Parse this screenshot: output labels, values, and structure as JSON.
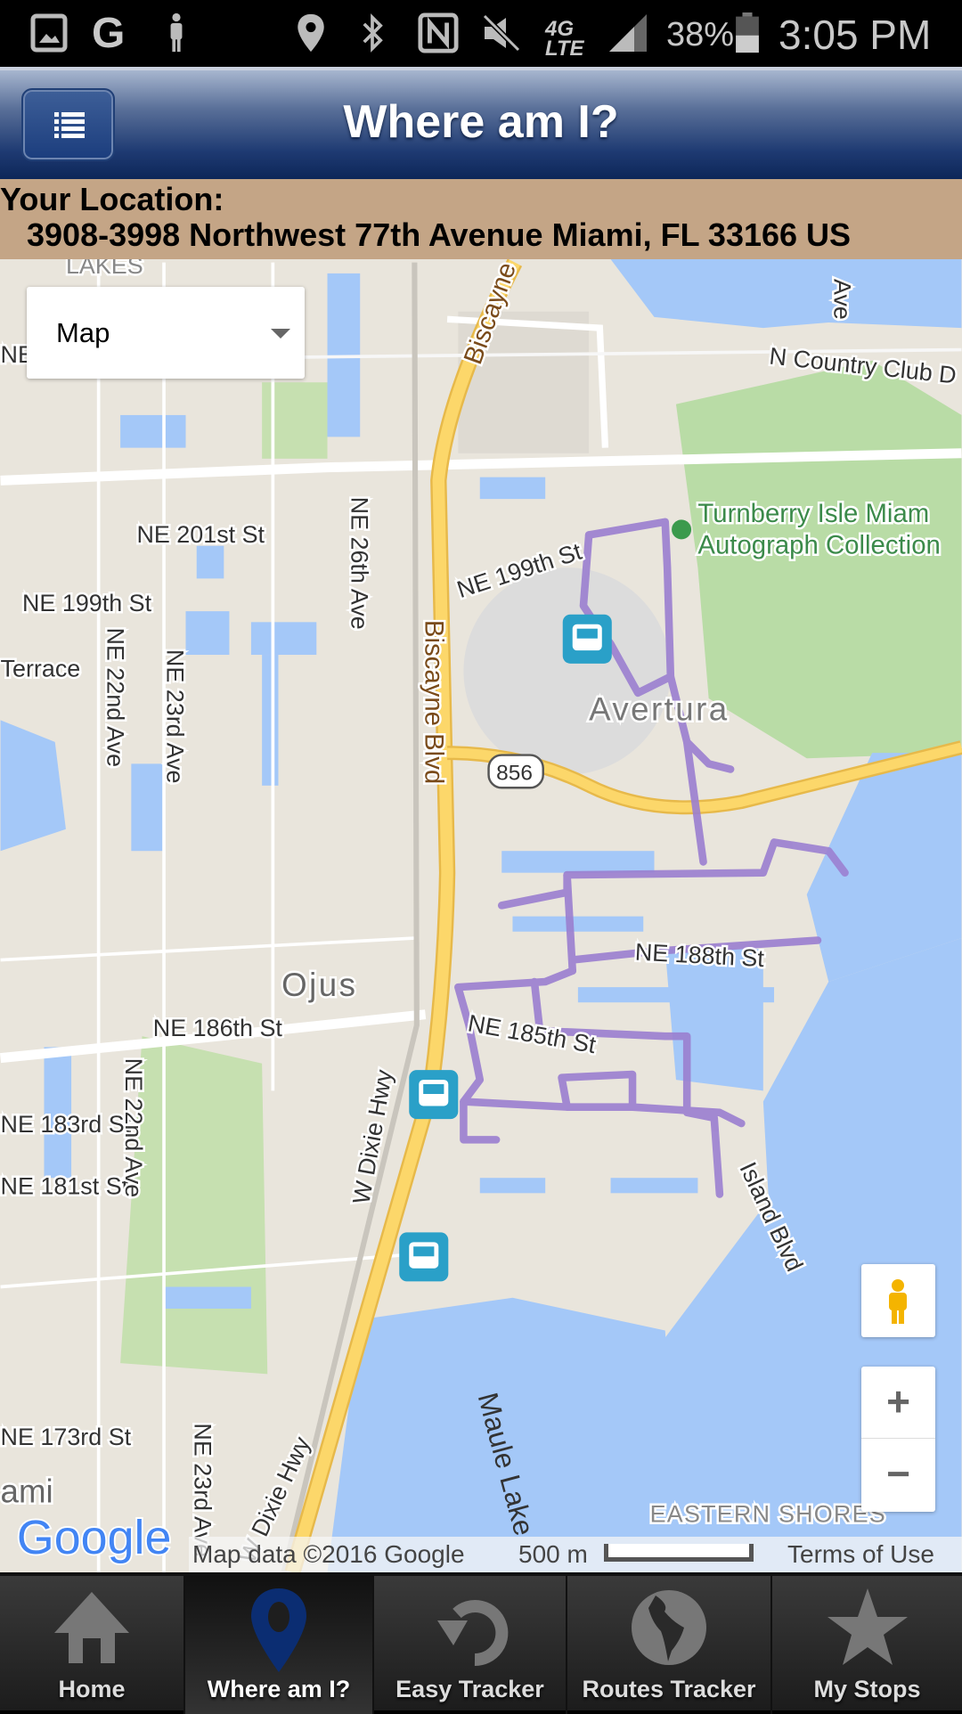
{
  "status_bar": {
    "battery": "38%",
    "time": "3:05 PM",
    "network": "4G LTE",
    "icons": [
      "gallery-icon",
      "google-icon",
      "pedestrian-icon",
      "location-icon",
      "bluetooth-icon",
      "nfc-icon",
      "mute-icon",
      "network-icon",
      "signal-icon",
      "battery-icon"
    ]
  },
  "header": {
    "title": "Where am I?",
    "menu_icon": "list-icon"
  },
  "location": {
    "label": "Your Location:",
    "address": "3908-3998 Northwest 77th Avenue Miami, FL 33166 US"
  },
  "map": {
    "map_type": "Map",
    "labels": [
      "NE 201st St",
      "NE 199th St",
      "Terrace",
      "NE 199th St",
      "NE 26th Ave",
      "NE 22nd Ave",
      "NE 23rd Ave",
      "Biscayne Blvd",
      "Biscayne",
      "N Country Club D",
      "Turnberry Isle Miam",
      "Autograph Collection",
      "Avertura",
      "856",
      "NE 188th St",
      "Ojus",
      "NE 186th St",
      "NE 185th St",
      "W Dixie Hwy",
      "NE 183rd St",
      "NE 181st St",
      "NE 22nd Ave",
      "Island Blvd",
      "Maule Lake",
      "NE 173rd St",
      "NE 23rd Ave",
      "W Dixie Hwy",
      "EASTERN SHORES",
      "ami",
      "LAKES",
      "NE",
      "Ave"
    ],
    "route_color": "#9b7fd0",
    "attribution": "Map data ©2016 Google",
    "scale": "500 m",
    "terms": "Terms of Use",
    "logo": "Google",
    "zoom_in": "+",
    "zoom_out": "−"
  },
  "nav": {
    "tabs": [
      {
        "label": "Home",
        "icon": "home-icon",
        "active": false
      },
      {
        "label": "Where am I?",
        "icon": "map-pin-icon",
        "active": true
      },
      {
        "label": "Easy Tracker",
        "icon": "refresh-icon",
        "active": false
      },
      {
        "label": "Routes Tracker",
        "icon": "globe-icon",
        "active": false
      },
      {
        "label": "My Stops",
        "icon": "star-icon",
        "active": false
      }
    ]
  }
}
